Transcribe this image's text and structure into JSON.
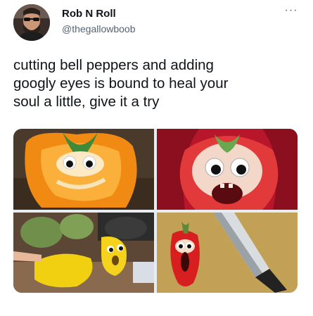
{
  "author": {
    "display_name": "Rob N Roll",
    "handle": "@thegallowboob",
    "avatar_icon": "bearded-man-avatar"
  },
  "more_icon": "more-options-icon",
  "more_label": "···",
  "tweet": {
    "lines": [
      "cutting bell peppers and adding",
      "googly eyes is bound to heal your",
      "soul a little, give it a try"
    ]
  },
  "media": {
    "photos": [
      {
        "subject": "orange-bell-pepper-googly-eyes-photo"
      },
      {
        "subject": "red-bell-pepper-half-googly-eyes-photo"
      },
      {
        "subject": "yellow-pepper-artichokes-knife-photo"
      },
      {
        "subject": "small-red-pepper-and-knife-photo"
      }
    ]
  },
  "colors": {
    "text_primary": "#0f1419",
    "text_secondary": "#536471",
    "background": "#ffffff"
  }
}
